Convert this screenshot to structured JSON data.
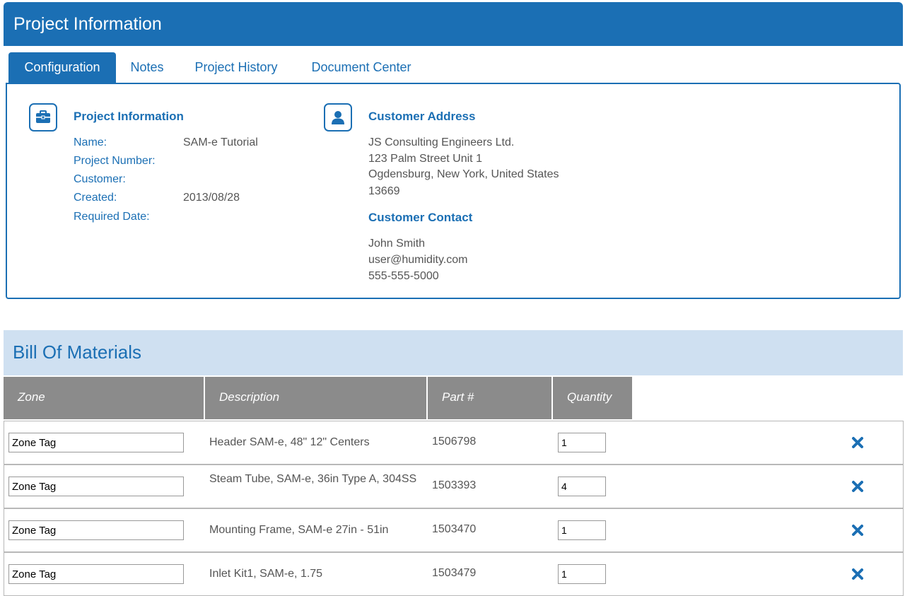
{
  "header": {
    "title": "Project Information"
  },
  "tabs": [
    {
      "label": "Configuration",
      "active": true
    },
    {
      "label": "Notes",
      "active": false
    },
    {
      "label": "Project History",
      "active": false
    },
    {
      "label": "Document Center",
      "active": false
    }
  ],
  "project_info": {
    "title": "Project Information",
    "icon": "briefcase-icon",
    "fields": [
      {
        "label": "Name:",
        "value": "SAM-e Tutorial"
      },
      {
        "label": "Project Number:",
        "value": ""
      },
      {
        "label": "Customer:",
        "value": ""
      },
      {
        "label": "Created:",
        "value": "2013/08/28"
      },
      {
        "label": "Required Date:",
        "value": ""
      }
    ]
  },
  "customer_address": {
    "title": "Customer Address",
    "icon": "person-icon",
    "lines": [
      "JS Consulting Engineers Ltd.",
      "123 Palm Street Unit 1",
      "Ogdensburg, New York, United States",
      "13669"
    ]
  },
  "customer_contact": {
    "title": "Customer Contact",
    "lines": [
      "John Smith",
      "user@humidity.com",
      "555-555-5000"
    ]
  },
  "bom": {
    "title": "Bill Of Materials",
    "columns": [
      "Zone",
      "Description",
      "Part #",
      "Quantity"
    ],
    "rows": [
      {
        "zone": "Zone Tag",
        "description": "Header SAM-e, 48\" 12\" Centers",
        "part": "1506798",
        "quantity": "1"
      },
      {
        "zone": "Zone Tag",
        "description": "Steam Tube, SAM-e, 36in Type A, 304SS",
        "part": "1503393",
        "quantity": "4"
      },
      {
        "zone": "Zone Tag",
        "description": "Mounting Frame, SAM-e 27in - 51in",
        "part": "1503470",
        "quantity": "1"
      },
      {
        "zone": "Zone Tag",
        "description": "Inlet Kit1, SAM-e, 1.75",
        "part": "1503479",
        "quantity": "1"
      }
    ]
  },
  "colors": {
    "primary": "#1b6fb4",
    "bom_header_bg": "#cfe0f1",
    "table_header_bg": "#8b8b8b",
    "text": "#555555"
  }
}
